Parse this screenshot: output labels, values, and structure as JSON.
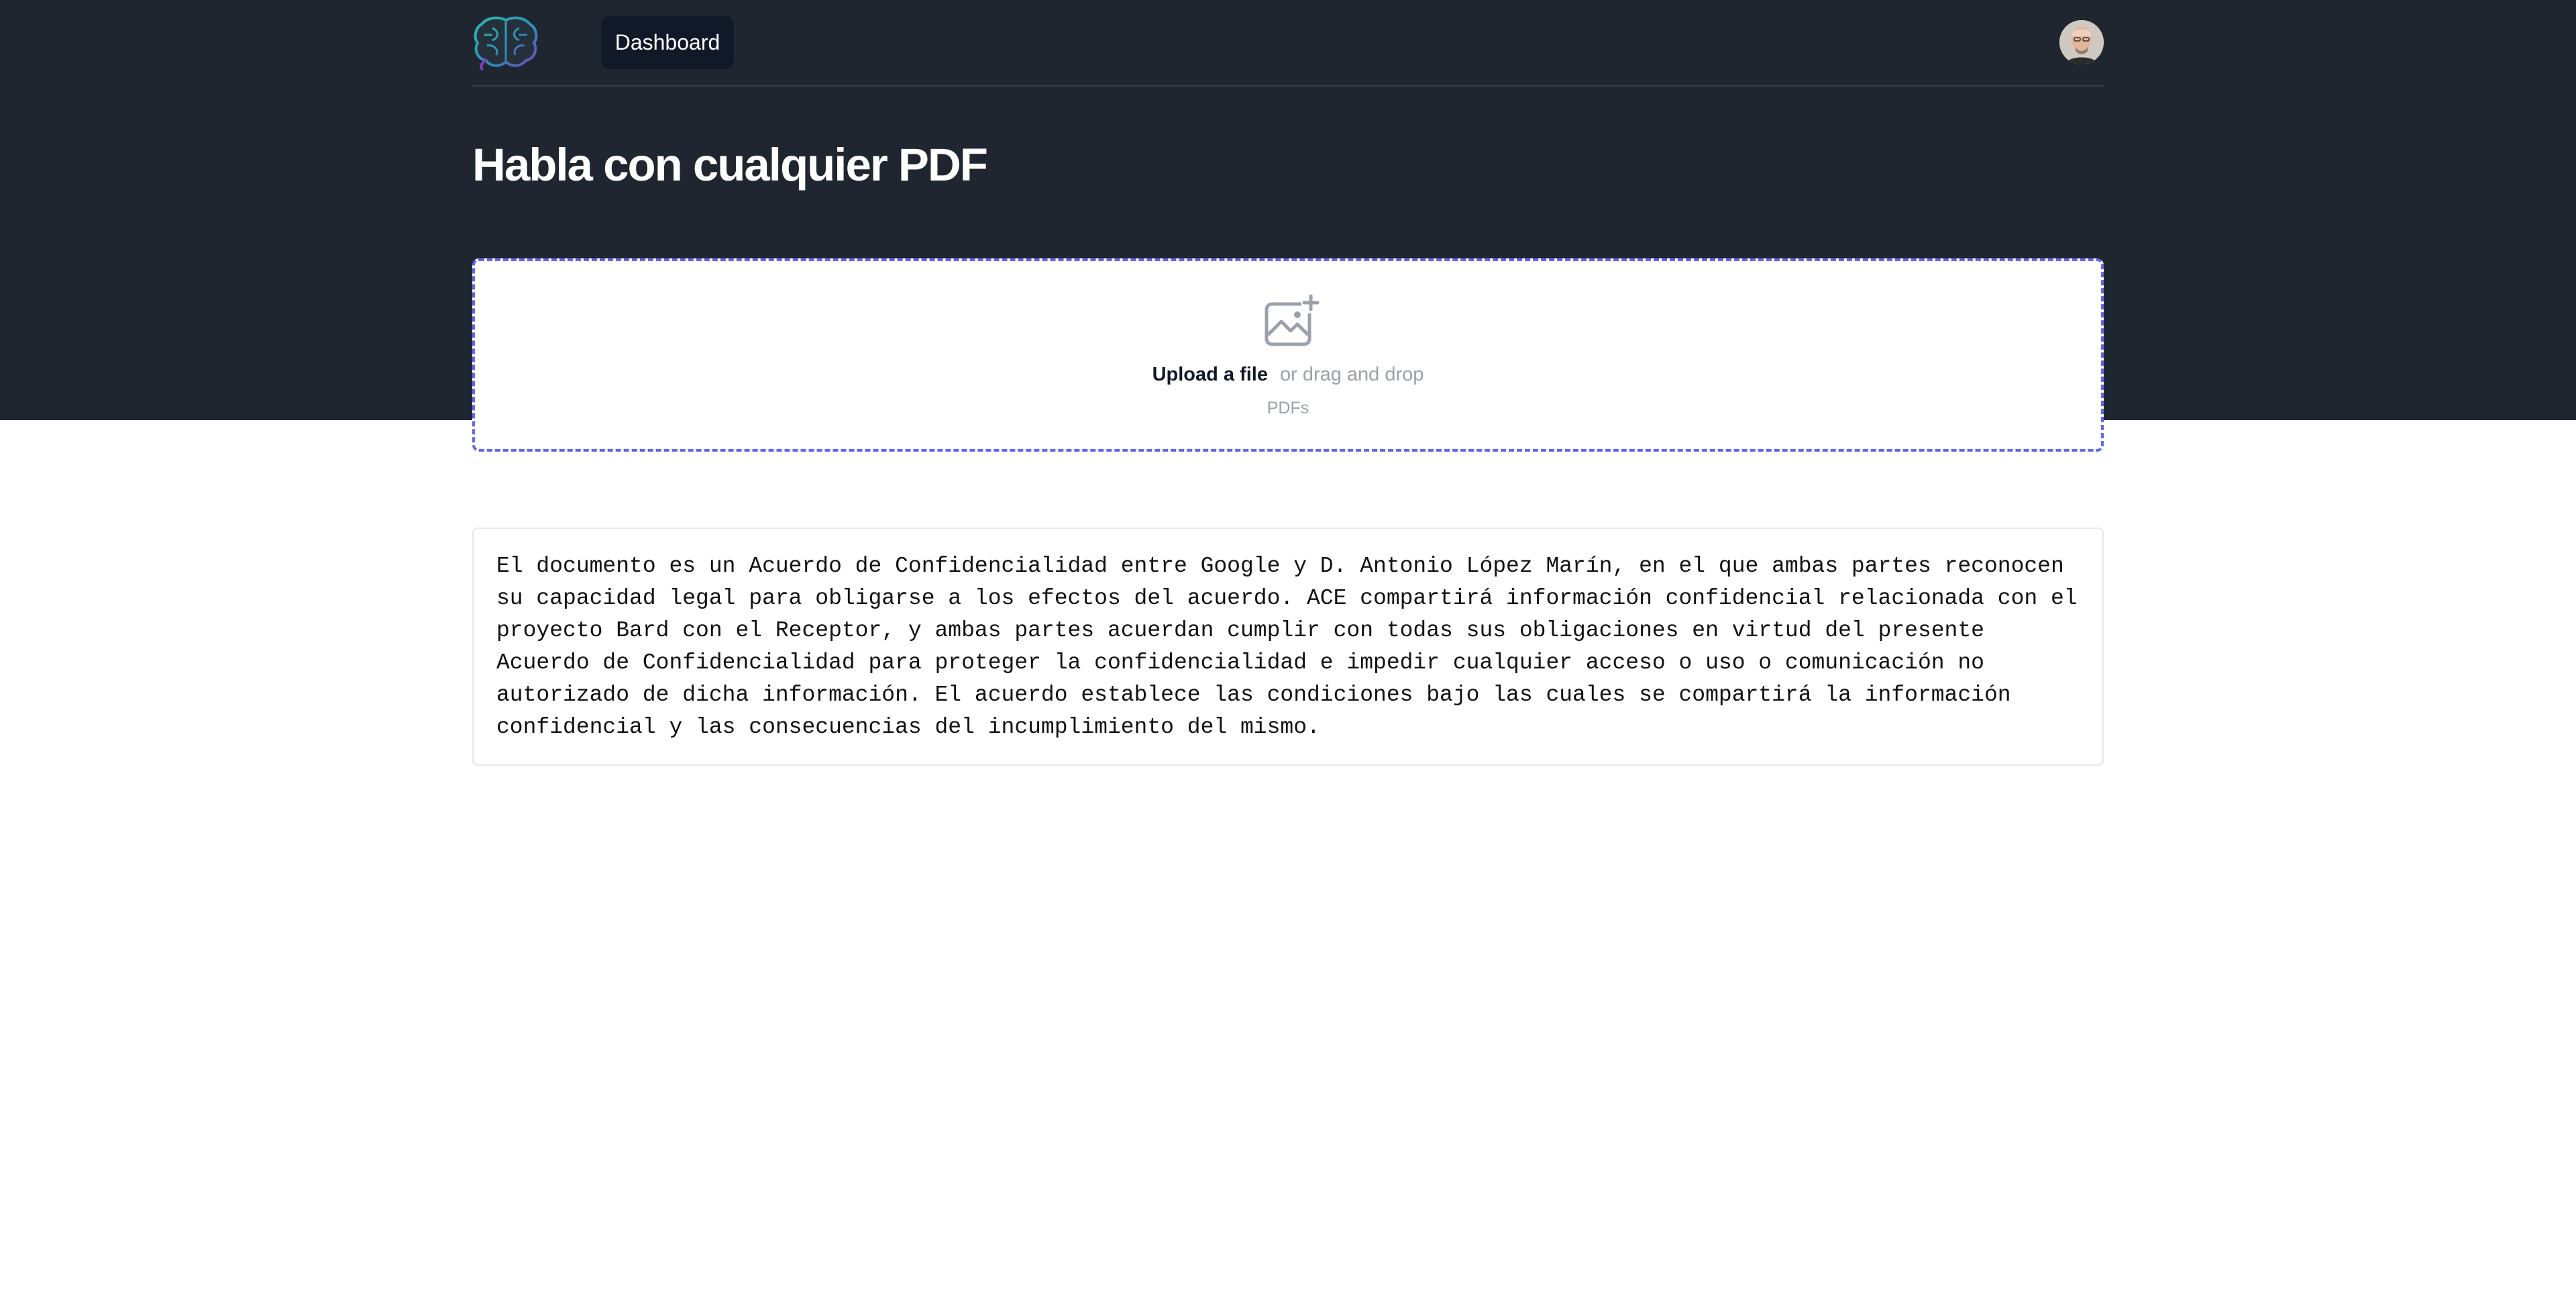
{
  "nav": {
    "dashboard_label": "Dashboard"
  },
  "page": {
    "title": "Habla con cualquier PDF"
  },
  "upload": {
    "link_label": "Upload a file",
    "hint": "or drag and drop",
    "accepted_types": "PDFs"
  },
  "summary": {
    "text": "El documento es un Acuerdo de Confidencialidad entre Google y D. Antonio López Marín, en el que ambas partes reconocen su capacidad legal para obligarse a los efectos del acuerdo. ACE compartirá información confidencial relacionada con el proyecto Bard con el Receptor, y ambas partes acuerdan cumplir con todas sus obligaciones en virtud del presente Acuerdo de Confidencialidad para proteger la confidencialidad e impedir cualquier acceso o uso o comunicación no autorizado de dicha información. El acuerdo establece las condiciones bajo las cuales se compartirá la información confidencial y las consecuencias del incumplimiento del mismo."
  },
  "colors": {
    "header_bg": "#1f2630",
    "accent_border": "#6366f1",
    "nav_active_bg": "#111827"
  },
  "icons": {
    "logo": "brain-logo-icon",
    "upload": "image-plus-icon",
    "avatar": "user-avatar"
  }
}
